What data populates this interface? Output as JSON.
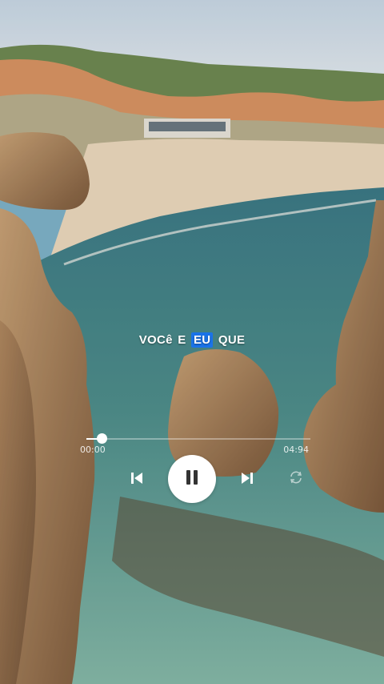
{
  "lyrics": {
    "words": [
      "VOCê",
      "E",
      "EU",
      "QUE"
    ],
    "highlighted_index": 2,
    "highlight_color": "#1a73e8"
  },
  "player": {
    "current_time": "00:00",
    "duration": "04:94",
    "progress_fraction": 0.07,
    "state": "playing"
  },
  "controls": {
    "previous_icon": "skip-previous-icon",
    "pause_icon": "pause-icon",
    "next_icon": "skip-next-icon",
    "repeat_icon": "repeat-icon"
  }
}
